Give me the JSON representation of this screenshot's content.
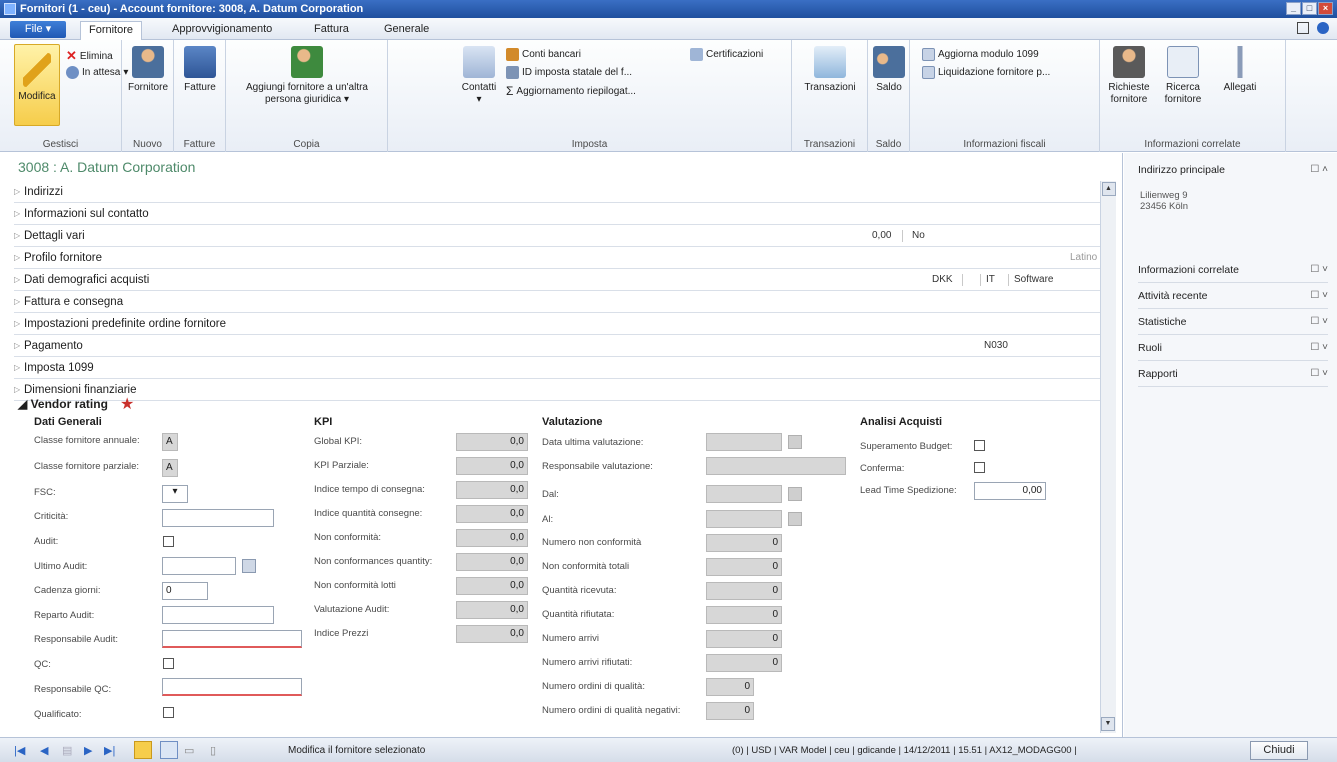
{
  "window": {
    "title": "Fornitori (1 - ceu) - Account fornitore: 3008, A. Datum Corporation"
  },
  "ribbon_tabs": {
    "file": "File",
    "fornitore": "Fornitore",
    "approvvigionamento": "Approvvigionamento",
    "fattura": "Fattura",
    "generale": "Generale"
  },
  "ribbon": {
    "modifica": "Modifica",
    "elimina": "Elimina",
    "in_attesa": "In attesa",
    "gestisci": "Gestisci",
    "fornitore": "Fornitore",
    "nuovo": "Nuovo",
    "fatture": "Fatture",
    "fatture_group": "Fatture",
    "aggiungi_fornitore": "Aggiungi fornitore a un'altra persona giuridica",
    "copia": "Copia",
    "contatti": "Contatti",
    "conti_bancari": "Conti bancari",
    "id_importa": "ID imposta statale del f...",
    "aggiornamento": "Aggiornamento riepilogat...",
    "certificazioni": "Certificazioni",
    "imposta": "Imposta",
    "transazioni": "Transazioni",
    "transazioni_group": "Transazioni",
    "saldo": "Saldo",
    "saldo_group": "Saldo",
    "aggiorna_modulo": "Aggiorna modulo 1099",
    "liquidazione": "Liquidazione fornitore p...",
    "info_fiscali": "Informazioni fiscali",
    "richieste_fornitore": "Richieste fornitore",
    "ricerca_fornitore": "Ricerca fornitore",
    "allegati": "Allegati",
    "info_correlate": "Informazioni correlate"
  },
  "record": {
    "title": "3008 : A. Datum Corporation"
  },
  "fasttabs": [
    "Indirizzi",
    "Informazioni sul contatto",
    "Dettagli vari",
    "Profilo fornitore",
    "Dati demografici acquisti",
    "Fattura e consegna",
    "Impostazioni predefinite ordine fornitore",
    "Pagamento",
    "Imposta 1099",
    "Dimensioni finanziarie"
  ],
  "fasttab_summaries": {
    "dettagli_value": "0,00",
    "dettagli_no": "No",
    "profilo": "Latino",
    "dati_dkk": "DKK",
    "dati_it": "IT",
    "dati_software": "Software",
    "pagamento": "N030"
  },
  "vendor_rating": {
    "title": "Vendor rating",
    "dati_generali": {
      "title": "Dati Generali",
      "classe_annuale_label": "Classe fornitore annuale:",
      "classe_annuale": "A",
      "classe_parziale_label": "Classe fornitore parziale:",
      "classe_parziale": "A",
      "fsc_label": "FSC:",
      "criticita_label": "Criticità:",
      "audit_label": "Audit:",
      "ultimo_audit_label": "Ultimo Audit:",
      "cadenza_label": "Cadenza giorni:",
      "cadenza": "0",
      "reparto_label": "Reparto Audit:",
      "responsabile_audit_label": "Responsabile Audit:",
      "qc_label": "QC:",
      "responsabile_qc_label": "Responsabile QC:",
      "qualificato_label": "Qualificato:"
    },
    "kpi": {
      "title": "KPI",
      "rows": [
        {
          "label": "Global KPI:",
          "value": "0,0"
        },
        {
          "label": "KPI Parziale:",
          "value": "0,0"
        },
        {
          "label": "Indice tempo di consegna:",
          "value": "0,0"
        },
        {
          "label": "Indice quantità consegne:",
          "value": "0,0"
        },
        {
          "label": "Non conformità:",
          "value": "0,0"
        },
        {
          "label": "Non conformances quantity:",
          "value": "0,0"
        },
        {
          "label": "Non conformità lotti",
          "value": "0,0"
        },
        {
          "label": "Valutazione Audit:",
          "value": "0,0"
        },
        {
          "label": "Indice Prezzi",
          "value": "0,0"
        }
      ]
    },
    "valutazione": {
      "title": "Valutazione",
      "data_ultima_label": "Data ultima valutazione:",
      "responsabile_label": "Responsabile valutazione:",
      "dal_label": "Dal:",
      "al_label": "Al:",
      "rows": [
        {
          "label": "Numero non conformità",
          "value": "0"
        },
        {
          "label": "Non conformità totali",
          "value": "0"
        },
        {
          "label": "Quantità ricevuta:",
          "value": "0"
        },
        {
          "label": "Quantità rifiutata:",
          "value": "0"
        },
        {
          "label": "Numero arrivi",
          "value": "0"
        },
        {
          "label": "Numero arrivi rifiutati:",
          "value": "0"
        },
        {
          "label": "Numero ordini di qualità:",
          "value": "0"
        },
        {
          "label": "Numero ordini di qualità negativi:",
          "value": "0"
        }
      ]
    },
    "analisi": {
      "title": "Analisi Acquisti",
      "superamento_label": "Superamento Budget:",
      "conferma_label": "Conferma:",
      "lead_time_label": "Lead Time Spedizione:",
      "lead_time": "0,00"
    }
  },
  "factbox": {
    "indirizzo": "Indirizzo principale",
    "address_line1": "Lilienweg 9",
    "address_line2": "23456 Köln",
    "items": [
      "Informazioni correlate",
      "Attività recente",
      "Statistiche",
      "Ruoli",
      "Rapporti"
    ]
  },
  "statusbar": {
    "message": "Modifica il fornitore selezionato",
    "right": "(0) | USD | VAR Model | ceu | gdicande | 14/12/2011 | 15.51 | AX12_MODAGG00 |",
    "chiudi": "Chiudi"
  },
  "colors": {
    "title_bar": "#1f4f9e",
    "modifica_highlight": "#f6cd4b",
    "record_title": "#4e8a6a",
    "required_underline": "#e05a5a"
  }
}
